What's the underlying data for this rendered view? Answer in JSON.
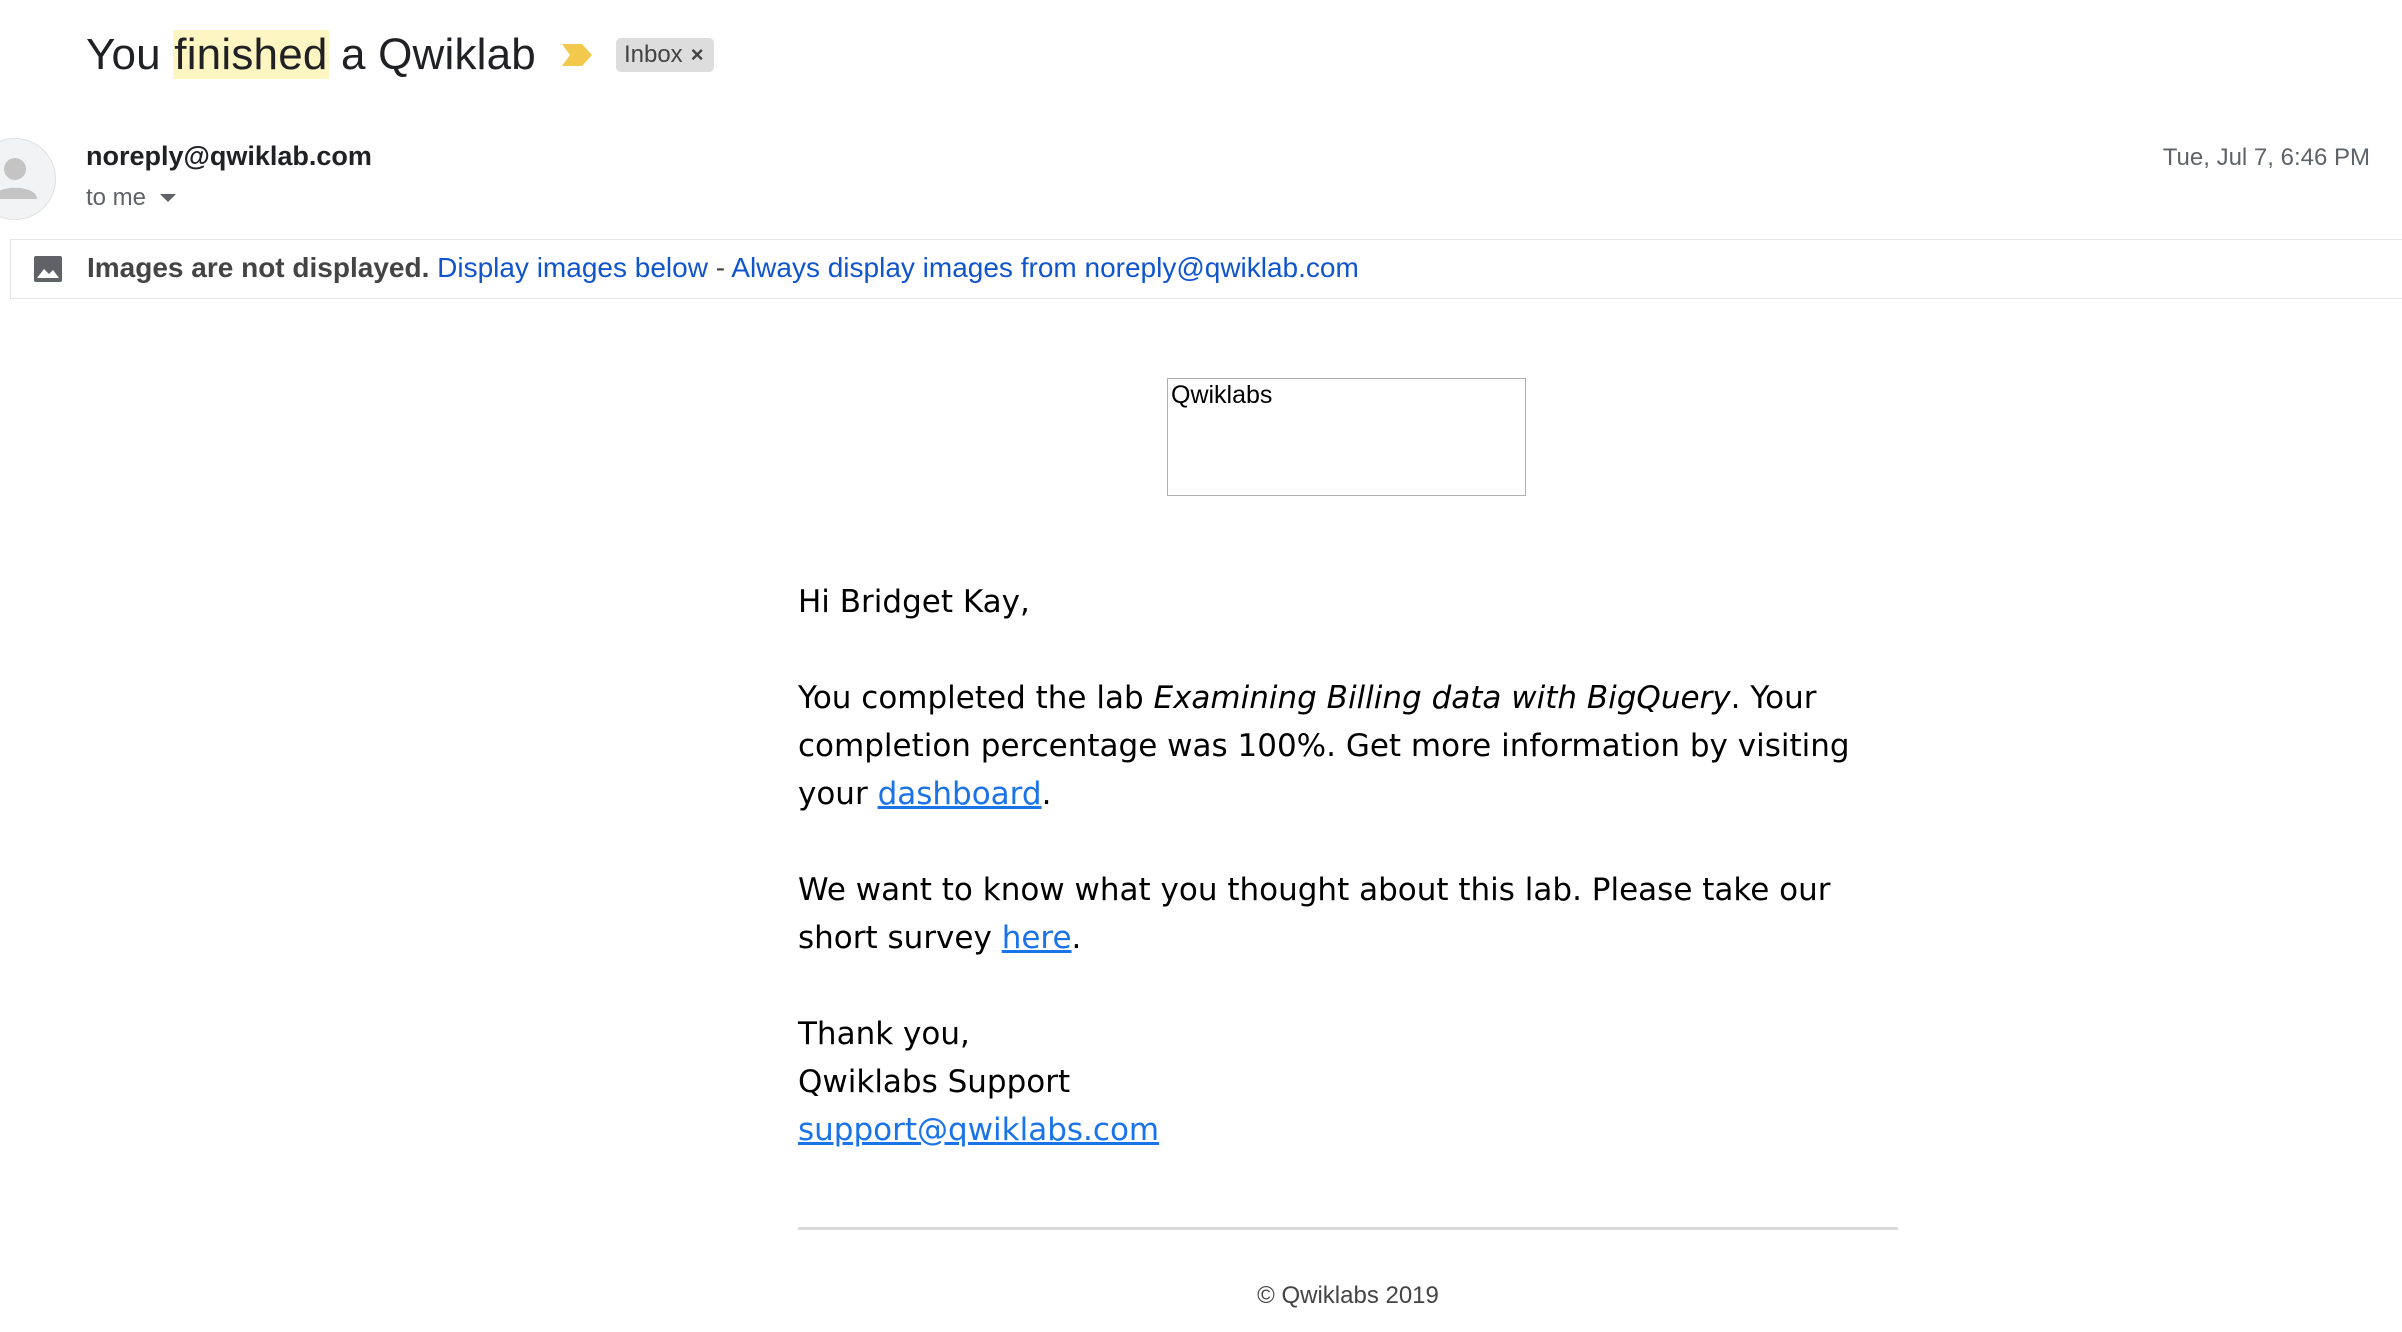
{
  "subject": {
    "pre": "You ",
    "highlight": "finished",
    "post": " a Qwiklab",
    "label_chip": "Inbox",
    "label_chip_close": "×"
  },
  "sender": {
    "email": "noreply@qwiklab.com",
    "recipient_summary": "to me",
    "timestamp": "Tue, Jul 7, 6:46 PM"
  },
  "images_banner": {
    "notice": "Images are not displayed.",
    "display_below": "Display images below",
    "separator": " - ",
    "always_display": "Always display images from noreply@qwiklab.com"
  },
  "logo": {
    "alt_text": "Qwiklabs"
  },
  "body": {
    "greeting": "Hi Bridget Kay,",
    "completion_pre": "You completed the lab ",
    "lab_name": "Examining Billing data with BigQuery",
    "completion_mid": ". Your completion percentage was 100%. Get more information by visiting your ",
    "dashboard_link": "dashboard",
    "period1": ".",
    "survey_pre": "We want to know what you thought about this lab. Please take our short survey ",
    "survey_link": "here",
    "period2": ".",
    "thanks": "Thank you,",
    "signature": "Qwiklabs Support",
    "support_email": "support@qwiklabs.com"
  },
  "footer": {
    "copyright": "© Qwiklabs 2019"
  },
  "colors": {
    "link_blue": "#1a73e8",
    "banner_link": "#1155cc",
    "highlight": "#fdf6c2",
    "important_marker": "#f2c94c"
  }
}
